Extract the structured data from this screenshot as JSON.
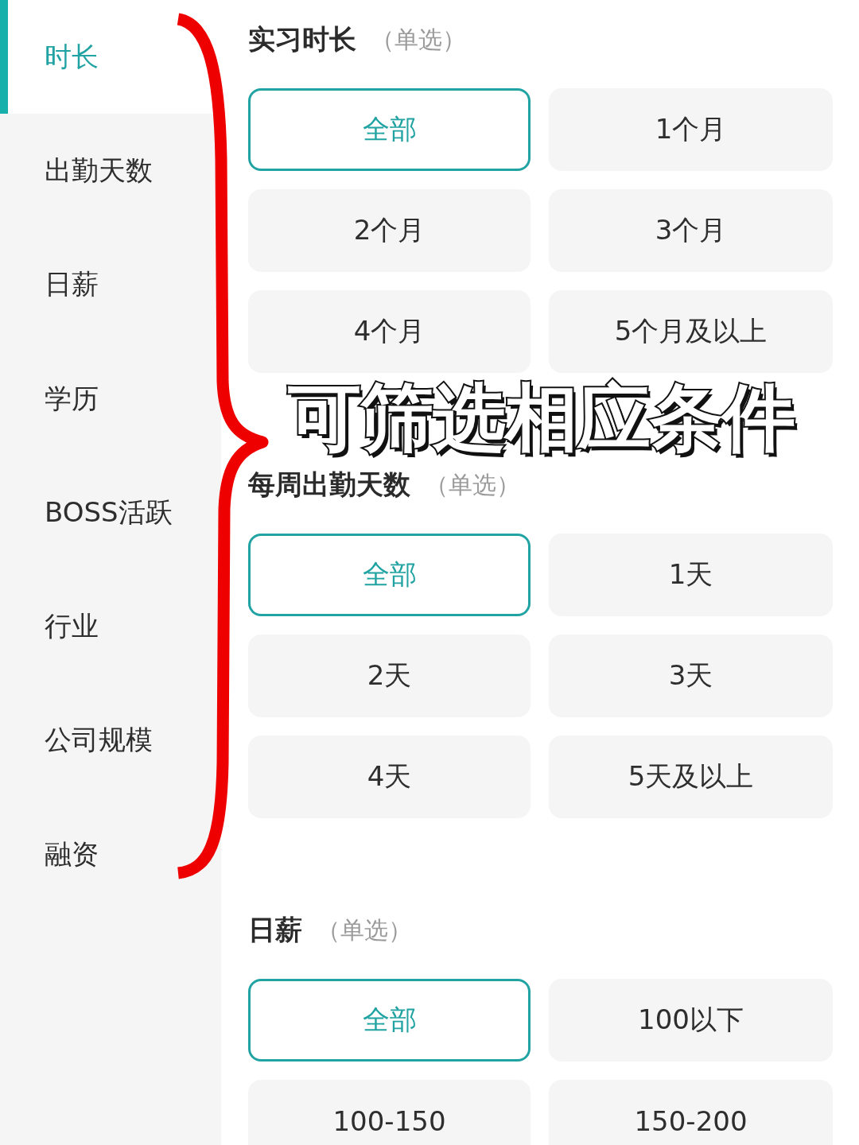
{
  "sidebar": {
    "items": [
      {
        "label": "时长",
        "selected": true
      },
      {
        "label": "出勤天数",
        "selected": false
      },
      {
        "label": "日薪",
        "selected": false
      },
      {
        "label": "学历",
        "selected": false
      },
      {
        "label": "BOSS活跃",
        "selected": false
      },
      {
        "label": "行业",
        "selected": false
      },
      {
        "label": "公司规模",
        "selected": false
      },
      {
        "label": "融资",
        "selected": false
      }
    ]
  },
  "sections": [
    {
      "title": "实习时长",
      "mode": "（单选）",
      "options": [
        {
          "label": "全部",
          "selected": true
        },
        {
          "label": "1个月",
          "selected": false
        },
        {
          "label": "2个月",
          "selected": false
        },
        {
          "label": "3个月",
          "selected": false
        },
        {
          "label": "4个月",
          "selected": false
        },
        {
          "label": "5个月及以上",
          "selected": false
        }
      ]
    },
    {
      "title": "每周出勤天数",
      "mode": "（单选）",
      "options": [
        {
          "label": "全部",
          "selected": true
        },
        {
          "label": "1天",
          "selected": false
        },
        {
          "label": "2天",
          "selected": false
        },
        {
          "label": "3天",
          "selected": false
        },
        {
          "label": "4天",
          "selected": false
        },
        {
          "label": "5天及以上",
          "selected": false
        }
      ]
    },
    {
      "title": "日薪",
      "mode": "（单选）",
      "options": [
        {
          "label": "全部",
          "selected": true
        },
        {
          "label": "100以下",
          "selected": false
        },
        {
          "label": "100-150",
          "selected": false
        },
        {
          "label": "150-200",
          "selected": false
        }
      ]
    }
  ],
  "annotation": {
    "caption": "可筛选相应条件"
  }
}
